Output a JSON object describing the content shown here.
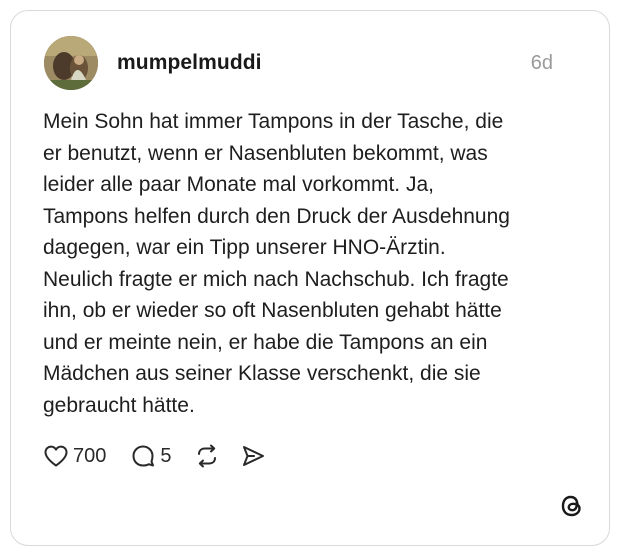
{
  "post": {
    "username": "mumpelmuddi",
    "time": "6d",
    "text": "Mein Sohn hat immer Tampons in der Tasche, die\ner benutzt, wenn er Nasenbluten bekommt, was\nleider alle paar Monate mal vorkommt. Ja,\nTampons helfen durch den Druck der Ausdehnung\ndagegen, war ein Tipp unserer HNO-Ärztin.\nNeulich fragte er mich nach Nachschub. Ich fragte\nihn, ob er wieder so oft Nasenbluten gehabt hätte\nund er meinte nein, er habe die Tampons an ein\nMädchen aus seiner Klasse verschenkt, die sie\ngebraucht hätte."
  },
  "actions": {
    "like_count": "700",
    "reply_count": "5",
    "like_icon": "heart-icon",
    "reply_icon": "comment-icon",
    "repost_icon": "repost-icon",
    "share_icon": "send-icon"
  },
  "branding": {
    "logo_icon": "threads-logo-icon"
  }
}
